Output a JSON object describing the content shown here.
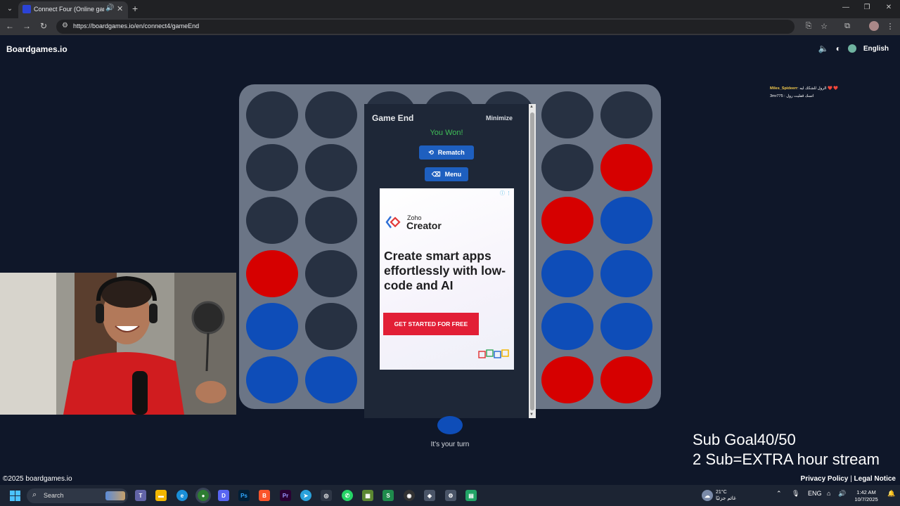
{
  "browser": {
    "tab_title": "Connect Four (Online game",
    "url": "https://boardgames.io/en/connect4/gameEnd"
  },
  "site": {
    "logo": "Boardgames.io",
    "language": "English"
  },
  "board": {
    "columns": [
      [
        "empty",
        "empty",
        "empty",
        "red",
        "blue",
        "blue"
      ],
      [
        "empty",
        "empty",
        "empty",
        "empty",
        "empty",
        "blue"
      ],
      [
        "empty",
        "empty",
        "empty",
        "empty",
        "empty",
        "empty"
      ],
      [
        "empty",
        "empty",
        "empty",
        "empty",
        "empty",
        "empty"
      ],
      [
        "empty",
        "empty",
        "empty",
        "empty",
        "empty",
        "empty"
      ],
      [
        "empty",
        "empty",
        "red",
        "blue",
        "blue",
        "red"
      ],
      [
        "empty",
        "red",
        "blue",
        "blue",
        "blue",
        "red"
      ]
    ],
    "colors": {
      "red": "#d60000",
      "blue": "#0e4db8",
      "empty": "#273142"
    }
  },
  "game_end": {
    "title": "Game End",
    "minimize": "Minimize",
    "status": "You Won!",
    "rematch": "Rematch",
    "menu": "Menu"
  },
  "ad": {
    "brand_small": "Zoho",
    "brand": "Creator",
    "headline": "Create smart apps effortlessly with low-code and AI",
    "cta": "GET STARTED FOR FREE"
  },
  "turn": {
    "text": "It's your turn",
    "color": "#0e4db8"
  },
  "chat": {
    "messages": [
      {
        "user": "Miles_Spideerr",
        "text": ": الرول للشكك ليه ❤️ ❤️"
      },
      {
        "user": "",
        "text": "3mr775 : اتسك قفليت رول"
      }
    ]
  },
  "stream": {
    "sub_goal": "Sub Goal40/50",
    "extra": "2 Sub=EXTRA hour stream"
  },
  "footer": {
    "copyright": "©2025 boardgames.io",
    "privacy": "Privacy Policy",
    "separator": " | ",
    "legal": "Legal Notice"
  },
  "taskbar": {
    "search": "Search",
    "weather_temp": "21°C",
    "weather_desc": "غائم جزئيًا",
    "lang": "ENG",
    "time": "1:42 AM",
    "date": "10/7/2025"
  }
}
